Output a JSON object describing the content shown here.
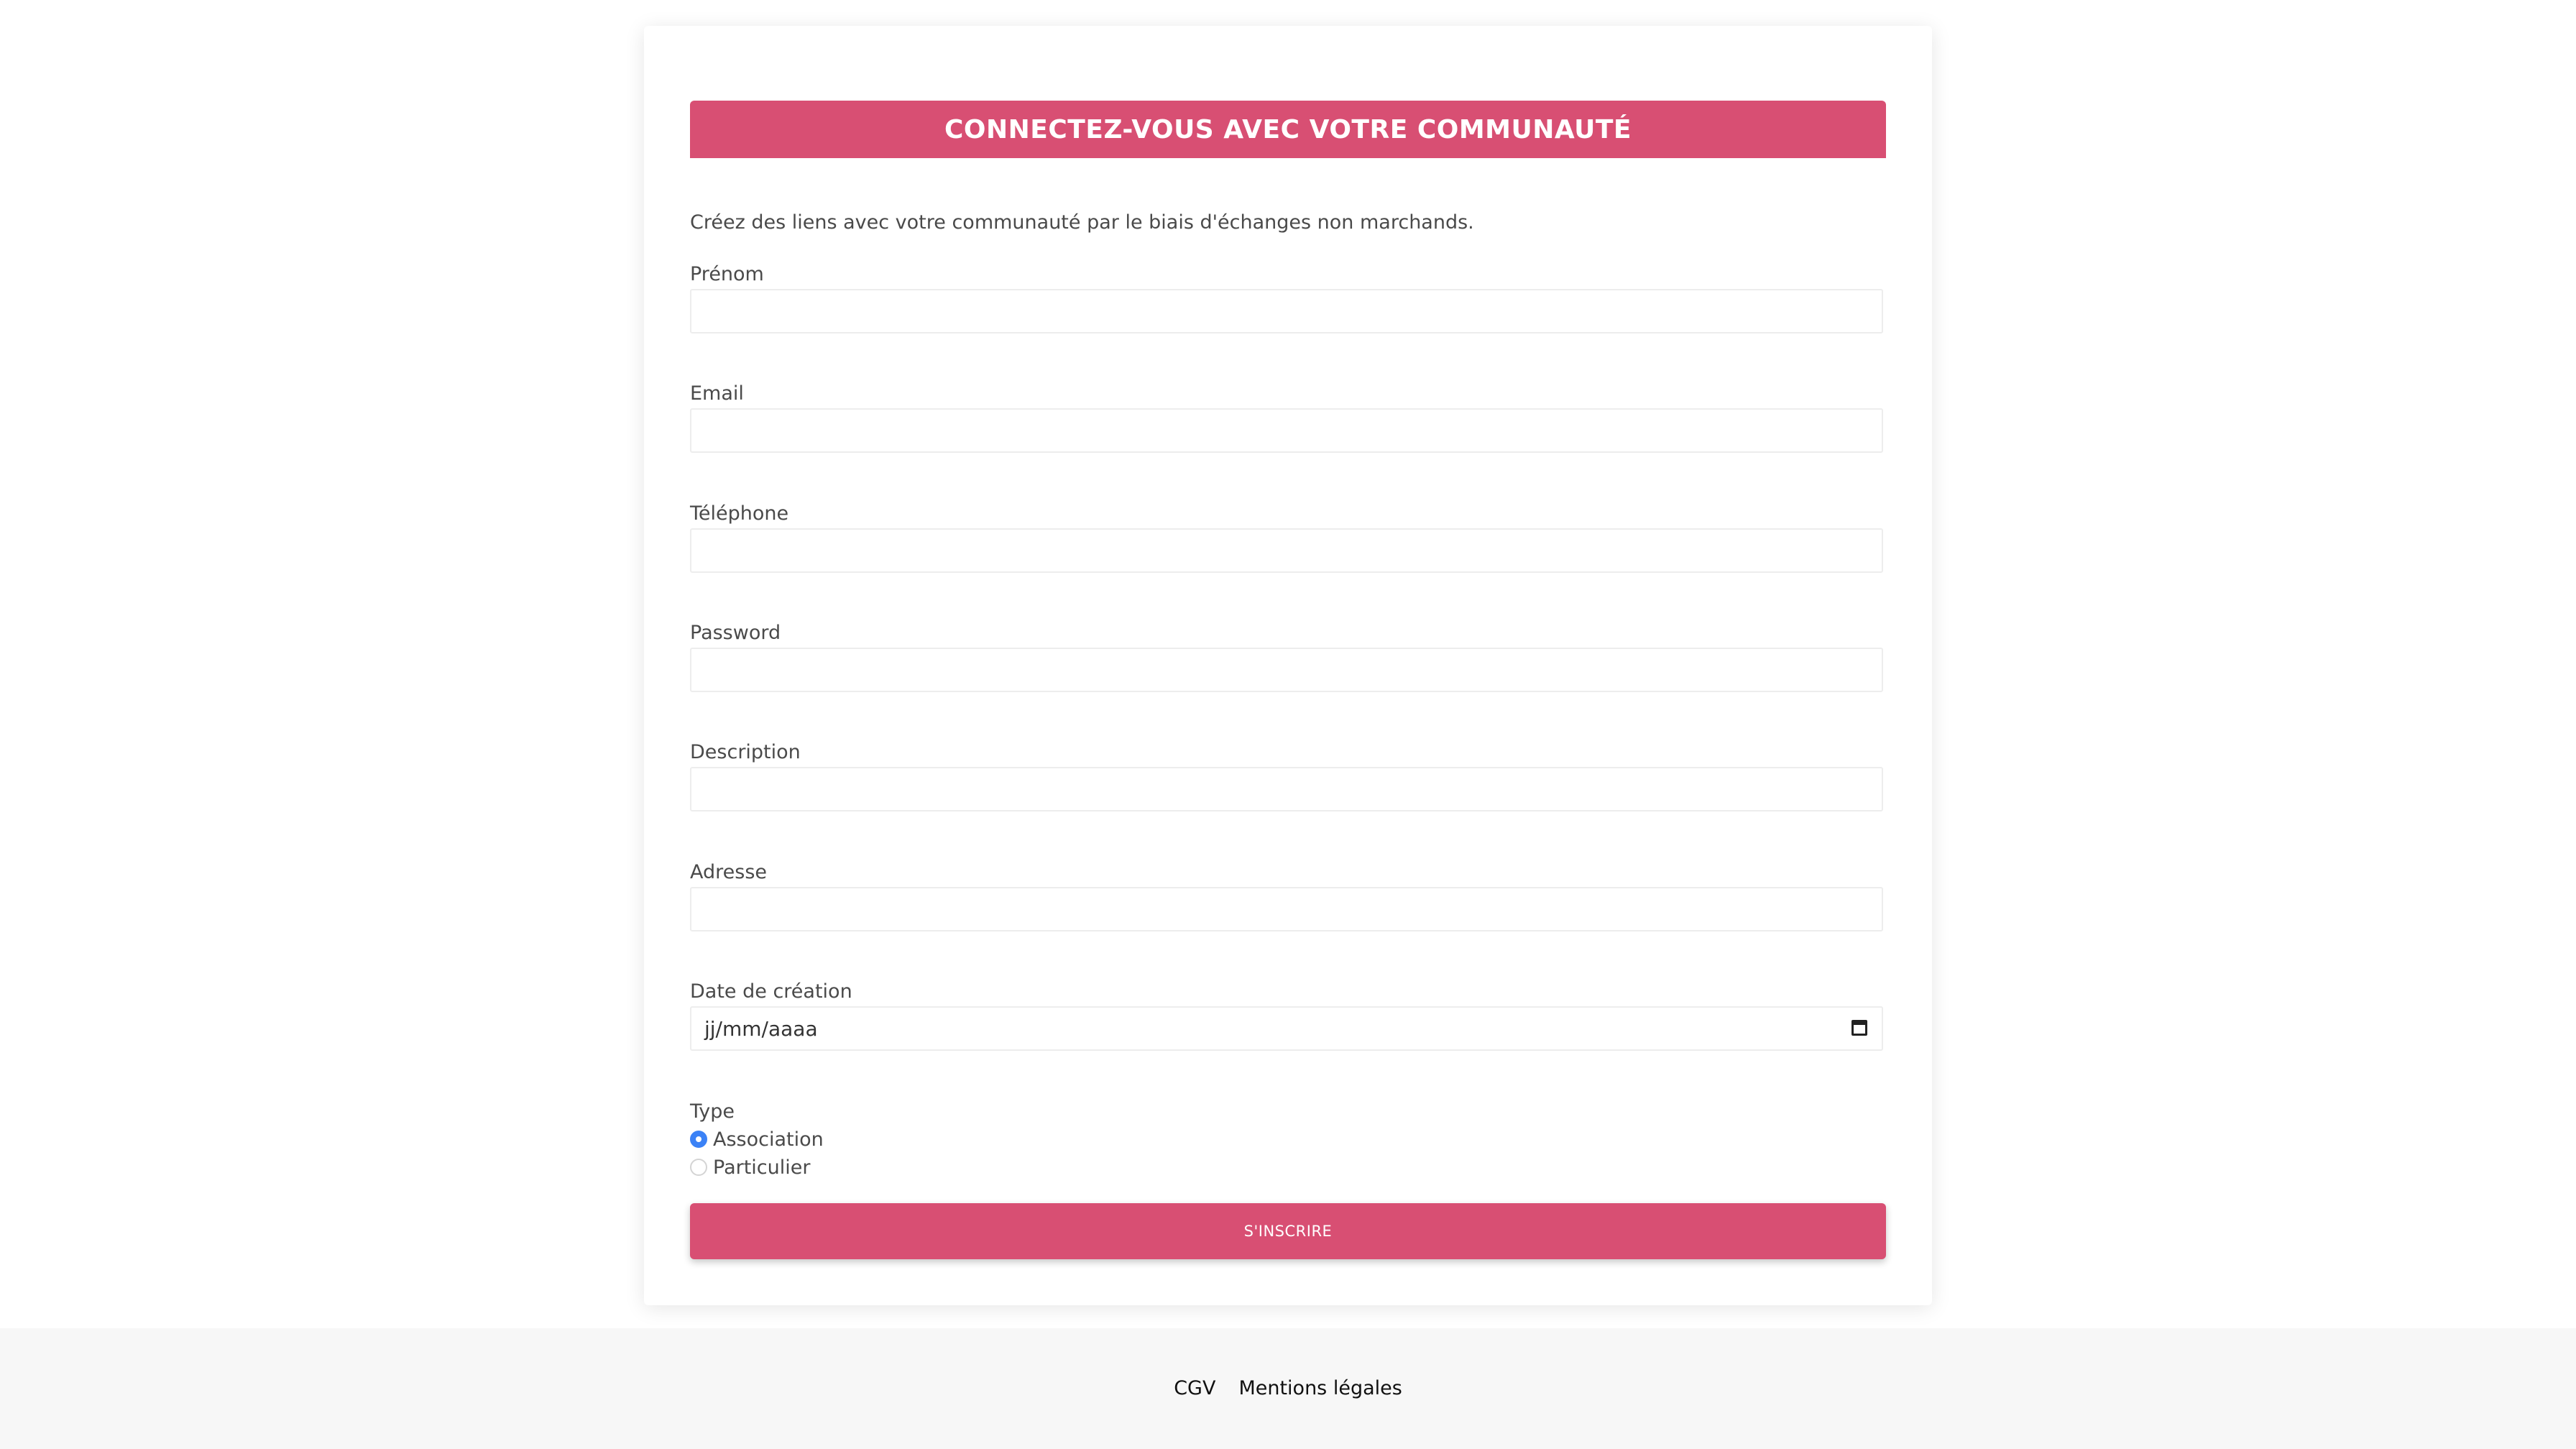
{
  "banner": {
    "title": "CONNECTEZ-VOUS AVEC VOTRE COMMUNAUTÉ"
  },
  "intro": "Créez des liens avec votre communauté par le biais d'échanges non marchands.",
  "form": {
    "fields": {
      "prenom": {
        "label": "Prénom",
        "value": ""
      },
      "email": {
        "label": "Email",
        "value": ""
      },
      "telephone": {
        "label": "Téléphone",
        "value": ""
      },
      "password": {
        "label": "Password",
        "value": ""
      },
      "description": {
        "label": "Description",
        "value": ""
      },
      "adresse": {
        "label": "Adresse",
        "value": ""
      },
      "date_creation": {
        "label": "Date de création",
        "placeholder": "jj/mm/aaaa"
      }
    },
    "type": {
      "label": "Type",
      "options": [
        {
          "label": "Association",
          "checked": true
        },
        {
          "label": "Particulier",
          "checked": false
        }
      ]
    },
    "submit_label": "S'INSCRIRE"
  },
  "footer": {
    "links": [
      "CGV",
      "Mentions légales"
    ]
  },
  "colors": {
    "accent": "#d84f73",
    "radio_checked": "#3b82f6",
    "footer_bg": "#f7f7f7"
  },
  "icons": {
    "date_picker": "calendar-icon"
  }
}
